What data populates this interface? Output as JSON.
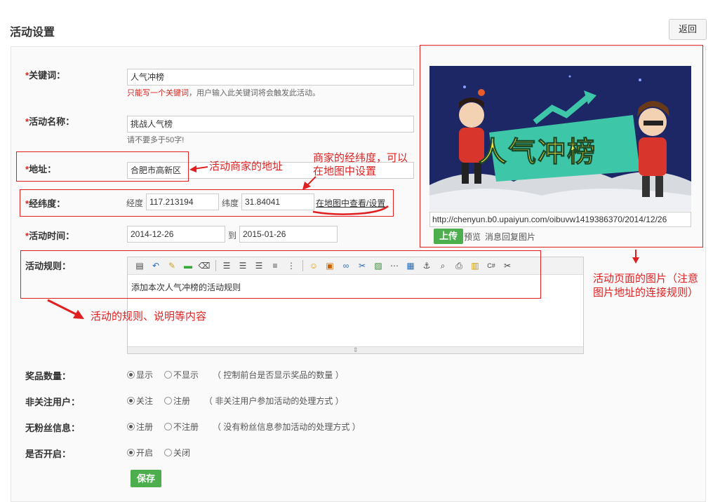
{
  "header": {
    "title": "活动设置",
    "back_label": "返回"
  },
  "form": {
    "keyword": {
      "label": "关键词：",
      "value": "人气冲榜",
      "hint_red": "只能写一个关键词",
      "hint_rest": "，用户输入此关键词将会触发此活动。"
    },
    "name": {
      "label": "活动名称：",
      "value": "挑战人气榜",
      "hint": "请不要多于50字!"
    },
    "address": {
      "label": "地址：",
      "value": "合肥市高新区"
    },
    "coords": {
      "label": "经纬度：",
      "lng_label": "经度",
      "lng_value": "117.213194",
      "lat_label": "纬度",
      "lat_value": "31.84041",
      "map_link": "在地图中查看/设置"
    },
    "time": {
      "label": "活动时间：",
      "start": "2014-12-26",
      "sep": "到",
      "end": "2015-01-26"
    },
    "rules": {
      "label": "活动规则：",
      "content": "添加本次人气冲榜的活动规则"
    },
    "prize_count": {
      "label": "奖品数量：",
      "opt1": "显示",
      "opt2": "不显示",
      "desc": "（ 控制前台是否显示奖品的数量 ）"
    },
    "non_follower": {
      "label": "非关注用户：",
      "opt1": "关注",
      "opt2": "注册",
      "desc": "（ 非关注用户参加活动的处理方式 ）"
    },
    "no_fans": {
      "label": "无粉丝信息：",
      "opt1": "注册",
      "opt2": "不注册",
      "desc": "（ 没有粉丝信息参加活动的处理方式 ）"
    },
    "enabled": {
      "label": "是否开启：",
      "opt1": "开启",
      "opt2": "关闭"
    },
    "save_label": "保存"
  },
  "image_panel": {
    "banner_text": "人气冲榜",
    "url": "http://chenyun.b0.upaiyun.com/oibuvw1419386370/2014/12/26",
    "upload_label": "上传",
    "preview_label": "预览",
    "reply_label": "消息回复图片"
  },
  "annotations": {
    "address_note": "活动商家的地址",
    "coords_note_1": "商家的经纬度，可以",
    "coords_note_2": "在地图中设置",
    "rules_note": "活动的规则、说明等内容",
    "image_note_1": "活动页面的图片（注意",
    "image_note_2": "图片地址的连接规则）"
  },
  "colors": {
    "annotation": "#e02020",
    "required": "#d9251d",
    "button_green": "#4cae4c"
  },
  "toolbar_icons": [
    "source-icon",
    "undo-icon",
    "clear-format-icon",
    "insert-line-icon",
    "eraser-icon",
    "align-left-icon",
    "align-center-icon",
    "align-right-icon",
    "ordered-list-icon",
    "unordered-list-icon",
    "emoticon-icon",
    "image-add-icon",
    "link-icon",
    "unlink-icon",
    "picture-icon",
    "table-grid-icon",
    "table-icon",
    "anchor-icon",
    "preview-icon",
    "print-icon",
    "template-icon",
    "code-icon",
    "cut-icon"
  ]
}
